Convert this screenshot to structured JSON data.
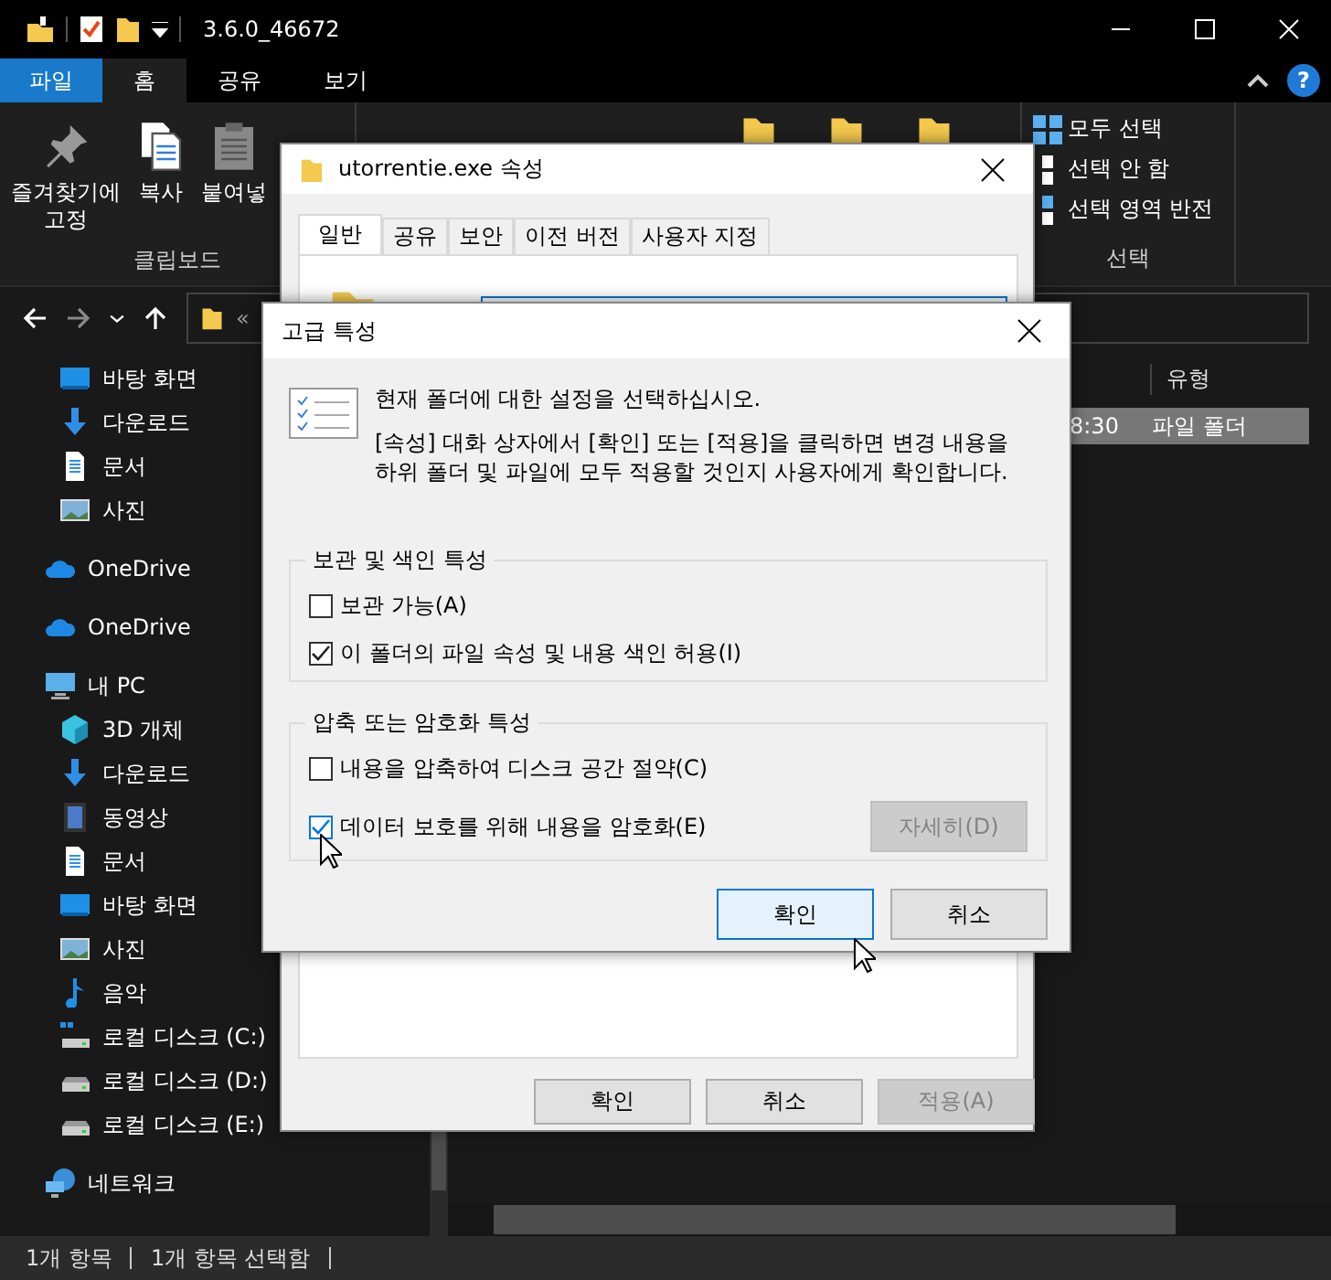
{
  "explorer": {
    "title": "3.6.0_46672",
    "file_tab": "파일",
    "ribbon_tabs": [
      {
        "label": "홈",
        "selected": true
      },
      {
        "label": "공유",
        "selected": false
      },
      {
        "label": "보기",
        "selected": false
      }
    ],
    "help_button": "?",
    "clipboard": {
      "buttons": [
        {
          "label": "즐겨찾기에\n고정",
          "kind": "pin"
        },
        {
          "label": "복사",
          "kind": "copy"
        },
        {
          "label": "붙여넣",
          "kind": "paste"
        }
      ],
      "group_label": "클립보드"
    },
    "select": {
      "items": [
        {
          "label": "모두 선택",
          "kind": "all"
        },
        {
          "label": "선택 안 함",
          "kind": "none"
        },
        {
          "label": "선택 영역 반전",
          "kind": "invert"
        }
      ],
      "group_label": "선택"
    },
    "address": {
      "text": "«"
    },
    "quick_access": [
      {
        "label": "바탕 화면",
        "kind": "desktop"
      },
      {
        "label": "다운로드",
        "kind": "download"
      },
      {
        "label": "문서",
        "kind": "document"
      },
      {
        "label": "사진",
        "kind": "pictures"
      }
    ],
    "sidebar": [
      {
        "label": "OneDrive",
        "kind": "cloud"
      },
      {
        "label": "OneDrive",
        "kind": "cloud"
      },
      {
        "label": "내 PC",
        "kind": "pc",
        "children": [
          {
            "label": "3D 개체",
            "kind": "cube"
          },
          {
            "label": "다운로드",
            "kind": "download"
          },
          {
            "label": "동영상",
            "kind": "video"
          },
          {
            "label": "문서",
            "kind": "document"
          },
          {
            "label": "바탕 화면",
            "kind": "desktop"
          },
          {
            "label": "사진",
            "kind": "pictures"
          },
          {
            "label": "음악",
            "kind": "music"
          },
          {
            "label": "로컬 디스크 (C:)",
            "kind": "system-drive"
          },
          {
            "label": "로컬 디스크 (D:)",
            "kind": "drive"
          },
          {
            "label": "로컬 디스크 (E:)",
            "kind": "drive"
          }
        ]
      },
      {
        "label": "네트워크",
        "kind": "network"
      }
    ],
    "columns": [
      "유형"
    ],
    "rows": [
      {
        "modified": "8:30",
        "type": "파일 폴더",
        "selected": true
      }
    ],
    "status": [
      "1개 항목",
      "1개 항목 선택함"
    ]
  },
  "properties": {
    "title": "utorrentie.exe 속성",
    "tabs": [
      {
        "label": "일반",
        "selected": true
      },
      {
        "label": "공유",
        "selected": false
      },
      {
        "label": "보안",
        "selected": false
      },
      {
        "label": "이전 버전",
        "selected": false
      },
      {
        "label": "사용자 지정",
        "selected": false
      }
    ],
    "buttons": [
      {
        "label": "확인",
        "disabled": false
      },
      {
        "label": "취소",
        "disabled": false
      },
      {
        "label": "적용(A)",
        "disabled": true
      }
    ]
  },
  "advanced": {
    "title": "고급 특성",
    "intro": "현재 폴더에 대한 설정을 선택하십시오.",
    "description": "[속성] 대화 상자에서 [확인] 또는 [적용]을 클릭하면 변경 내용을 하위 폴더 및 파일에 모두 적용할 것인지 사용자에게 확인합니다.",
    "groups": [
      {
        "title": "보관 및 색인 특성",
        "options": [
          {
            "label": "보관 가능(A)",
            "checked": false,
            "hover": false
          },
          {
            "label": "이 폴더의 파일 속성 및 내용 색인 허용(I)",
            "checked": true,
            "hover": false
          }
        ]
      },
      {
        "title": "압축 또는 암호화 특성",
        "options": [
          {
            "label": "내용을 압축하여 디스크 공간 절약(C)",
            "checked": false,
            "hover": false
          },
          {
            "label": "데이터 보호를 위해 내용을 암호화(E)",
            "checked": true,
            "hover": true
          }
        ],
        "details_button": {
          "label": "자세히(D)",
          "disabled": true
        }
      }
    ],
    "buttons": [
      {
        "label": "확인",
        "default": true
      },
      {
        "label": "취소",
        "default": false
      }
    ]
  }
}
